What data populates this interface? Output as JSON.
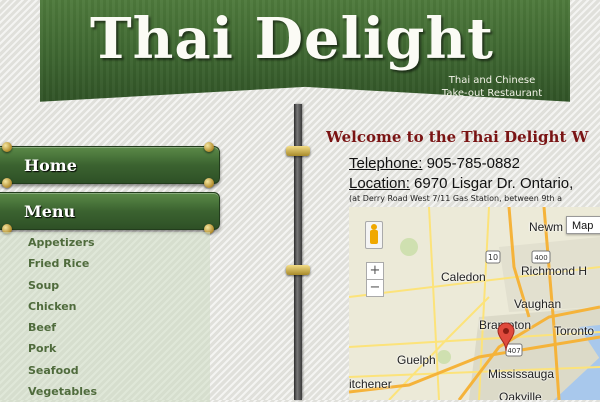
{
  "header": {
    "site_title": "Thai Delight",
    "tagline_line1": "Thai and Chinese",
    "tagline_line2": "Take-out Restaurant"
  },
  "nav": {
    "home_label": "Home",
    "menu_label": "Menu",
    "menu_items": [
      "Appetizers",
      "Fried Rice",
      "Soup",
      "Chicken",
      "Beef",
      "Pork",
      "Seafood",
      "Vegetables"
    ]
  },
  "content": {
    "welcome": "Welcome to the Thai Delight W",
    "telephone_label": "Telephone:",
    "telephone_value": " 905-785-0882",
    "location_label": "Location:",
    "location_value": " 6970 Lisgar Dr. Ontario, ",
    "location_note": "(at Derry Road West 7/11 Gas Station, between 9th a"
  },
  "map": {
    "type_button": "Map",
    "zoom_in": "+",
    "zoom_out": "−",
    "places": {
      "newm": "Newm",
      "caledon": "Caledon",
      "richmond_hill": "Richmond H",
      "vaughan": "Vaughan",
      "brampton": "Brampton",
      "toronto": "Toronto",
      "guelph": "Guelph",
      "mississauga": "Mississauga",
      "kitchener": "itchener",
      "oakville": "Oakville"
    },
    "route_badges": {
      "r10": "10",
      "r400": "400",
      "r407": "407"
    },
    "colors": {
      "lake": "#a8c8ec",
      "highway": "#f5b33a",
      "road": "#fce37a",
      "urban": "#d7d5c4"
    }
  },
  "colors": {
    "banner": "#3d6530",
    "welcome_text": "#7a1414",
    "menu_item_text": "#4f6b3c"
  }
}
